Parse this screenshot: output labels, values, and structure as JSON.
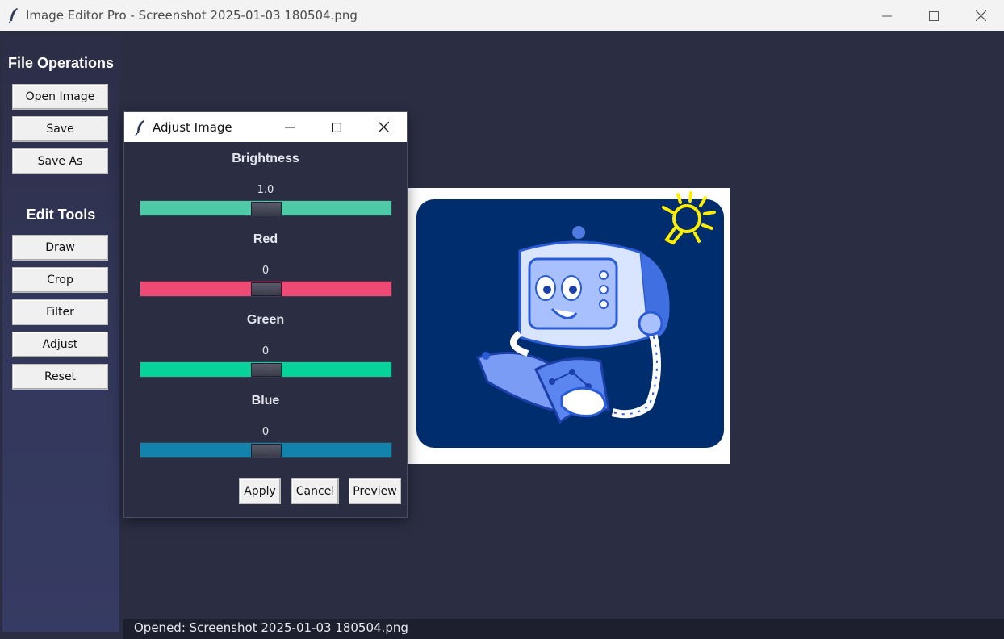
{
  "window": {
    "title": "Image Editor Pro - Screenshot 2025-01-03 180504.png"
  },
  "sidebar": {
    "file_section_title": "File Operations",
    "file_buttons": [
      "Open Image",
      "Save",
      "Save As"
    ],
    "edit_section_title": "Edit Tools",
    "edit_buttons": [
      "Draw",
      "Crop",
      "Filter",
      "Adjust",
      "Reset"
    ]
  },
  "dialog": {
    "title": "Adjust Image",
    "sliders": [
      {
        "label": "Brightness",
        "value": "1.0",
        "color": "#4ecba6",
        "level": 0.5
      },
      {
        "label": "Red",
        "value": "0",
        "color": "#ef4a75",
        "level": 0.5
      },
      {
        "label": "Green",
        "value": "0",
        "color": "#06d39a",
        "level": 0.5
      },
      {
        "label": "Blue",
        "value": "0",
        "color": "#1283ab",
        "level": 0.5
      }
    ],
    "buttons": {
      "apply": "Apply",
      "cancel": "Cancel",
      "preview": "Preview"
    }
  },
  "status": {
    "text": "Opened: Screenshot 2025-01-03 180504.png"
  },
  "colors": {
    "background": "#2b2d42",
    "sidebar": "#33375a",
    "image_bg": "#002d6e",
    "lightbulb": "#ffee00"
  },
  "icons": [
    "feather-icon",
    "minimize-icon",
    "maximize-icon",
    "close-icon"
  ]
}
